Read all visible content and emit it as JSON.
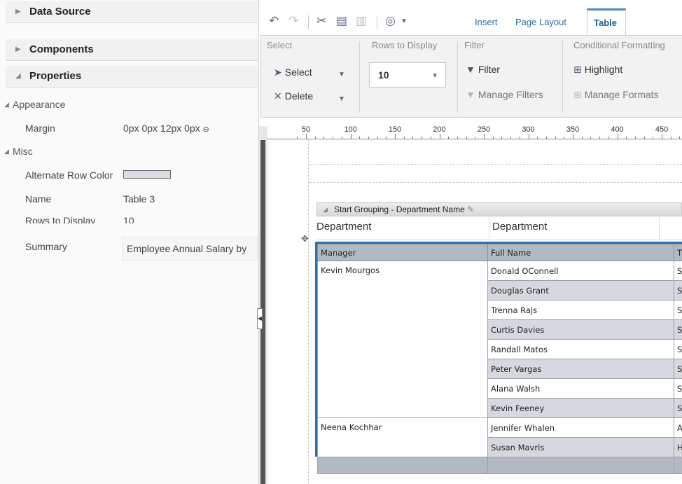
{
  "left_panel": {
    "sections": [
      {
        "label": "Data Source",
        "expanded": false
      },
      {
        "label": "Components",
        "expanded": false
      },
      {
        "label": "Properties",
        "expanded": true
      }
    ],
    "appearance": {
      "label": "Appearance",
      "margin_label": "Margin",
      "margin_value": "0px 0px 12px 0px"
    },
    "misc": {
      "label": "Misc",
      "alt_row_color_label": "Alternate Row Color",
      "alt_row_color": "#d9dde6",
      "name_label": "Name",
      "name_value": "Table 3",
      "rows_label": "Rows to Display",
      "rows_value": "10",
      "summary_label": "Summary",
      "summary_value": "Employee Annual Salary by"
    }
  },
  "toolbar": {
    "tabs": [
      "Insert",
      "Page Layout",
      "Table"
    ],
    "active_tab": "Table",
    "icons": [
      "undo-icon",
      "redo-icon",
      "cut-icon",
      "copy-icon",
      "paste-icon",
      "data-icon",
      "dropdown-icon"
    ],
    "groups": {
      "select": {
        "title": "Select",
        "select_label": "Select",
        "delete_label": "Delete"
      },
      "rows": {
        "title": "Rows to Display",
        "value": "10"
      },
      "filter": {
        "title": "Filter",
        "filter_label": "Filter",
        "manage_label": "Manage Filters"
      },
      "conditional": {
        "title": "Conditional Formatting",
        "highlight_label": "Highlight",
        "manage_label": "Manage Formats"
      }
    }
  },
  "ruler": {
    "labels": [
      "50",
      "100",
      "150",
      "200",
      "250",
      "300",
      "350",
      "400",
      "450"
    ]
  },
  "canvas": {
    "grouping_label": "Start Grouping - Department Name",
    "department_label": "Department",
    "department_value": "Department",
    "table": {
      "headers": [
        "Manager",
        "Full Name",
        "T"
      ],
      "rows": [
        {
          "manager": "Kevin Mourgos",
          "full_name": "Donald OConnell",
          "third": "S"
        },
        {
          "manager": "",
          "full_name": "Douglas Grant",
          "third": "S"
        },
        {
          "manager": "",
          "full_name": "Trenna Rajs",
          "third": "S"
        },
        {
          "manager": "",
          "full_name": "Curtis Davies",
          "third": "S"
        },
        {
          "manager": "",
          "full_name": "Randall Matos",
          "third": "S"
        },
        {
          "manager": "",
          "full_name": "Peter Vargas",
          "third": "S"
        },
        {
          "manager": "",
          "full_name": "Alana Walsh",
          "third": "S"
        },
        {
          "manager": "",
          "full_name": "Kevin Feeney",
          "third": "S"
        },
        {
          "manager": "Neena Kochhar",
          "full_name": "Jennifer Whalen",
          "third": "A"
        },
        {
          "manager": "",
          "full_name": "Susan Mavris",
          "third": "H"
        }
      ]
    }
  },
  "colors": {
    "accent": "#2f6dab",
    "header_bg": "#b3b9c2",
    "alt_row": "#d5d8de"
  }
}
